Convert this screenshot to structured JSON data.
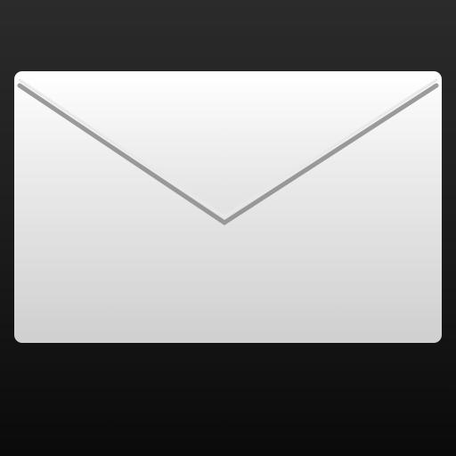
{
  "icon": {
    "name": "mail-envelope-icon",
    "background": {
      "top": "#2b2b2b",
      "bottom": "#0a0a0a"
    },
    "envelope": {
      "body_top": "#ffffff",
      "body_bottom": "#cfcfcf",
      "flap_line": "#8a8a8a",
      "flap_highlight": "#e8e8e8"
    }
  }
}
